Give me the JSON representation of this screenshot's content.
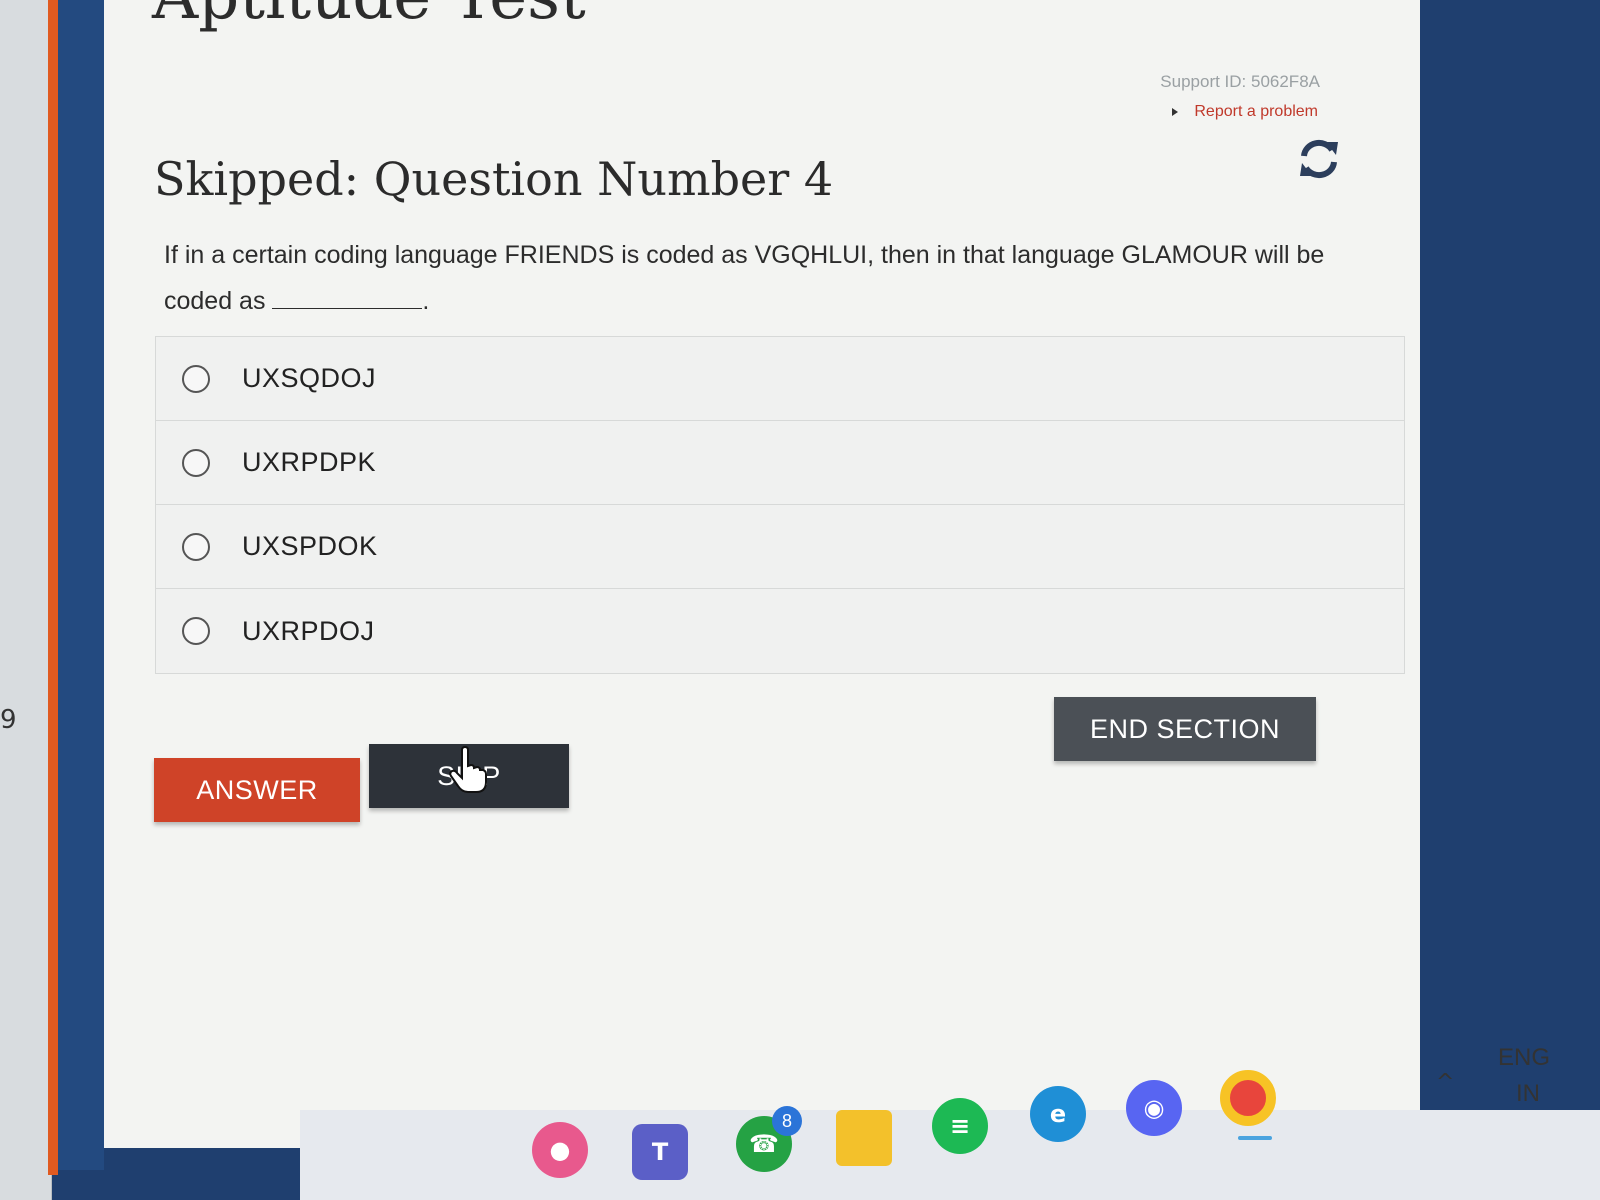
{
  "page": {
    "title_partial": "Aptitude Test",
    "support_id": "Support ID: 5062F8A",
    "report_link": "Report a problem",
    "heading": "Skipped: Question Number 4",
    "question_text": "If in a certain coding language FRIENDS is coded as VGQHLUI, then in that language GLAMOUR will be coded as",
    "question_end": "."
  },
  "options": [
    {
      "label": "UXSQDOJ",
      "selected": false
    },
    {
      "label": "UXRPDPK",
      "selected": false
    },
    {
      "label": "UXSPDOK",
      "selected": false
    },
    {
      "label": "UXRPDOJ",
      "selected": false
    }
  ],
  "buttons": {
    "answer": "ANSWER",
    "skip": "SKIP",
    "end_section": "END SECTION"
  },
  "icons": {
    "refresh": "refresh-icon",
    "cursor": "hand-cursor-icon"
  },
  "taskbar": {
    "whatsapp_badge": "8",
    "lang_top": "ENG",
    "lang_bottom": "IN"
  },
  "left_edge_text": "9",
  "colors": {
    "answer_button": "#cf4328",
    "skip_button": "#2d3239",
    "end_section_button": "#4b5056",
    "report_link": "#c0392b"
  }
}
